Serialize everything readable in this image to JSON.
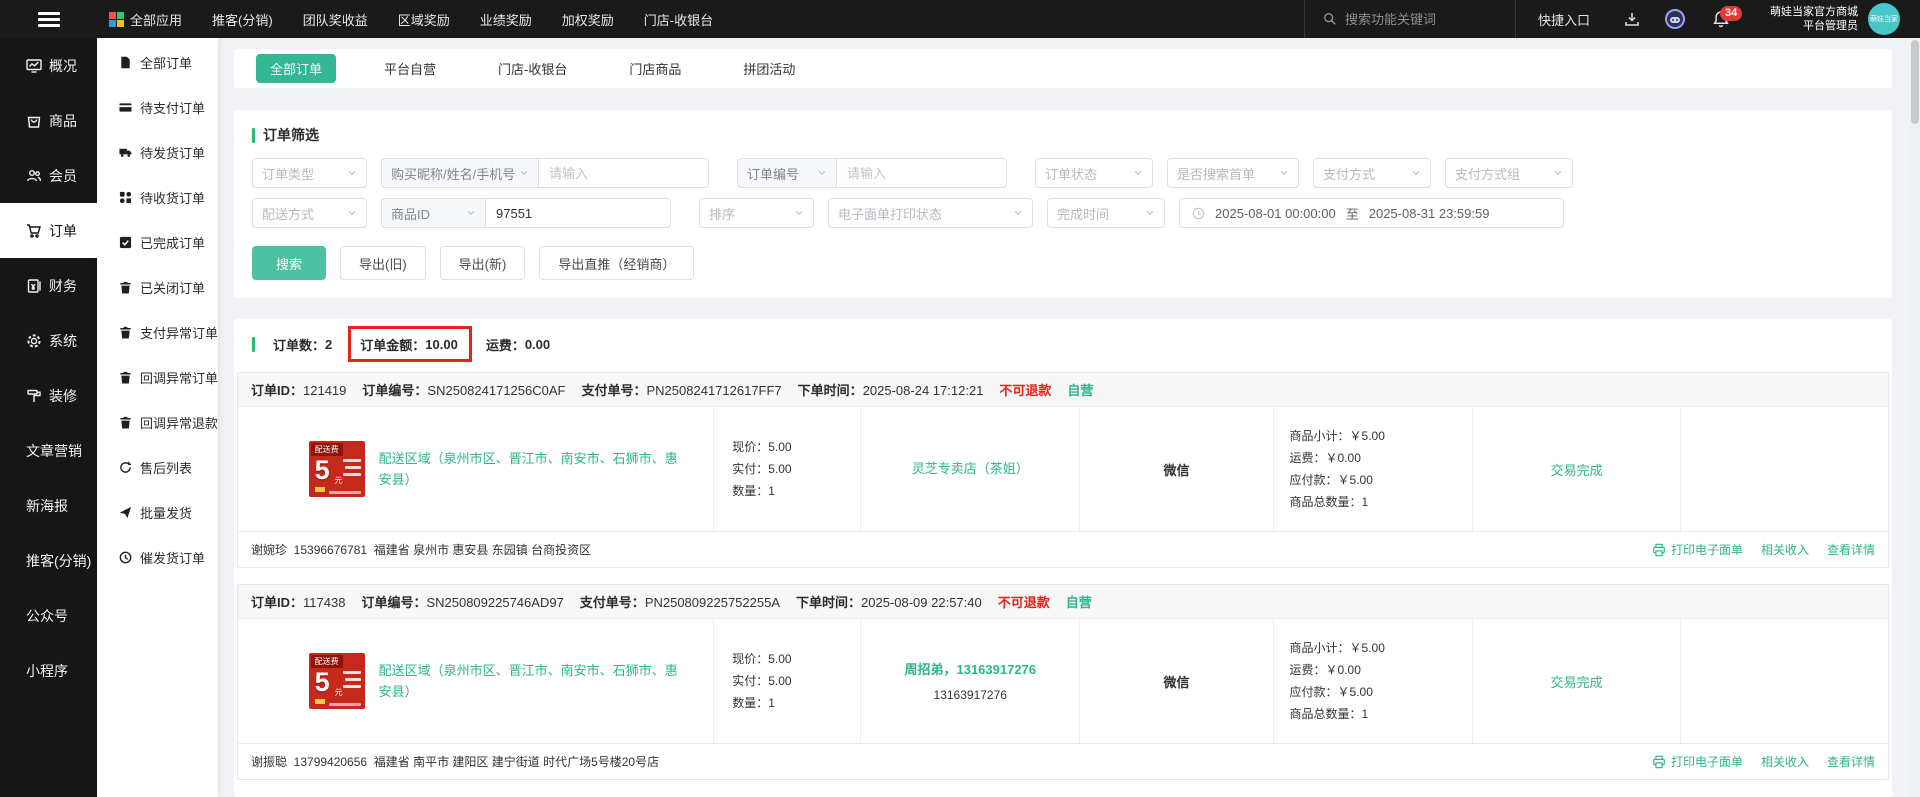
{
  "topbar": {
    "apps": "全部应用",
    "nav": [
      "推客(分销)",
      "团队奖收益",
      "区域奖励",
      "业绩奖励",
      "加权奖励",
      "门店-收银台"
    ],
    "search_placeholder": "搜索功能关键词",
    "quick_entry": "快捷入口",
    "badge": "34",
    "shop_name": "萌娃当家官方商城",
    "role": "平台管理员",
    "avatar_text": "萌娃当家"
  },
  "sidebar": {
    "items": [
      "概况",
      "商品",
      "会员",
      "订单",
      "财务",
      "系统",
      "装修",
      "文章营销",
      "新海报",
      "推客(分销)",
      "公众号",
      "小程序"
    ]
  },
  "order_menu": [
    "全部订单",
    "待支付订单",
    "待发货订单",
    "待收货订单",
    "已完成订单",
    "已关闭订单",
    "支付异常订单",
    "回调异常订单",
    "回调异常退款",
    "售后列表",
    "批量发货",
    "催发货订单"
  ],
  "tabs": [
    "全部订单",
    "平台自营",
    "门店-收银台",
    "门店商品",
    "拼团活动"
  ],
  "filter": {
    "title": "订单筛选",
    "order_type": "订单类型",
    "buyer_key": "购买昵称/姓名/手机号",
    "input_placeholder": "请输入",
    "order_no_key": "订单编号",
    "order_status": "订单状态",
    "first_order": "是否搜索首单",
    "pay_way": "支付方式",
    "pay_way_group": "支付方式组",
    "delivery": "配送方式",
    "goods_id_key": "商品ID",
    "goods_id_value": "97551",
    "sort": "排序",
    "eprint_status": "电子面单打印状态",
    "finish_time": "完成时间",
    "date_start": "2025-08-01 00:00:00",
    "date_sep": "至",
    "date_end": "2025-08-31 23:59:59",
    "btn_search": "搜索",
    "btn_export_old": "导出(旧)",
    "btn_export_new": "导出(新)",
    "btn_export_direct": "导出直推（经销商）"
  },
  "summary": {
    "count_label": "订单数：",
    "count": "2",
    "amount_label": "订单金额：",
    "amount": "10.00",
    "freight_label": "运费：",
    "freight": "0.00"
  },
  "product_badge": {
    "tag": "配送费",
    "num": "5",
    "unit": "元"
  },
  "orders": [
    {
      "id_label": "订单ID：",
      "id": "121419",
      "sn_label": "订单编号：",
      "sn": "SN250824171256C0AF",
      "pay_label": "支付单号：",
      "pay_no": "PN2508241712617FF7",
      "time_label": "下单时间：",
      "time": "2025-08-24 17:12:21",
      "tag_refund": "不可退款",
      "tag_source": "自营",
      "product_name": "配送区域（泉州市区、晋江市、南安市、石狮市、惠安县）",
      "price_lines": [
        "现价：5.00",
        "实付：5.00",
        "数量：1"
      ],
      "buyer_main": "灵芝专卖店（茶姐）",
      "buyer_sub": "",
      "pay_channel": "微信",
      "totals": [
        "商品小计：￥5.00",
        "运费：￥0.00",
        "应付款：￥5.00",
        "商品总数量：1"
      ],
      "status": "交易完成",
      "receiver": "谢婉珍  15396676781  福建省 泉州市 惠安县 东园镇 台商投资区",
      "action_print": "打印电子面单",
      "action_income": "相关收入",
      "action_detail": "查看详情"
    },
    {
      "id_label": "订单ID：",
      "id": "117438",
      "sn_label": "订单编号：",
      "sn": "SN250809225746AD97",
      "pay_label": "支付单号：",
      "pay_no": "PN250809225752255A",
      "time_label": "下单时间：",
      "time": "2025-08-09 22:57:40",
      "tag_refund": "不可退款",
      "tag_source": "自营",
      "product_name": "配送区域（泉州市区、晋江市、南安市、石狮市、惠安县）",
      "price_lines": [
        "现价：5.00",
        "实付：5.00",
        "数量：1"
      ],
      "buyer_main": "周招弟，13163917276",
      "buyer_sub": "13163917276",
      "pay_channel": "微信",
      "totals": [
        "商品小计：￥5.00",
        "运费：￥0.00",
        "应付款：￥5.00",
        "商品总数量：1"
      ],
      "status": "交易完成",
      "receiver": "谢振聪  13799420656  福建省 南平市 建阳区 建宁街道 时代广场5号楼20号店",
      "action_print": "打印电子面单",
      "action_income": "相关收入",
      "action_detail": "查看详情"
    }
  ]
}
